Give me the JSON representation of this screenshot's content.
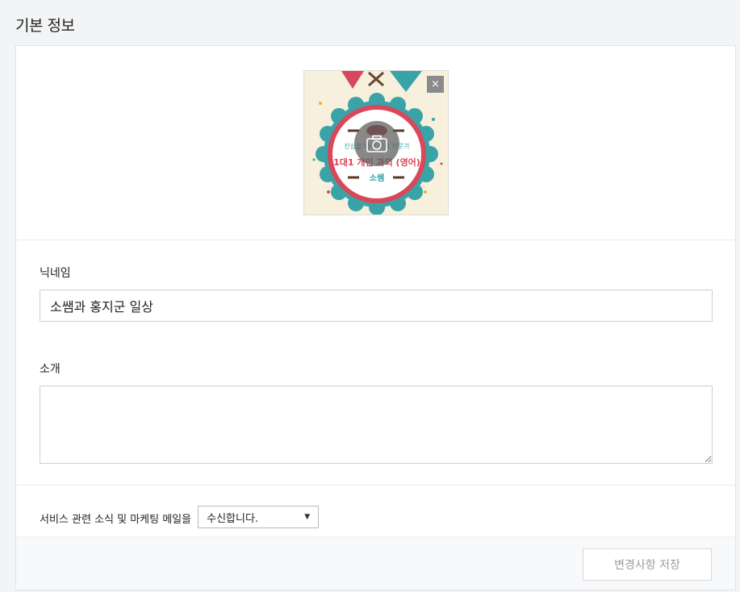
{
  "page": {
    "title": "기본 정보"
  },
  "profile": {
    "remove_label": "×",
    "image": {
      "line1": "진심을 다해 코치 전문가",
      "line2": "1대1 개인 과외 (영어)",
      "line3": "소쌤"
    }
  },
  "form": {
    "nickname_label": "닉네임",
    "nickname_value": "소쌤과 홍지군 일상",
    "intro_label": "소개",
    "intro_value": "",
    "mail_label": "서비스 관련 소식 및 마케팅 메일을",
    "mail_option": "수신합니다."
  },
  "footer": {
    "save_label": "변경사항 저장"
  },
  "colors": {
    "accent_teal": "#3aa3a8",
    "accent_red": "#d8485a",
    "cream": "#f6f0dc"
  }
}
